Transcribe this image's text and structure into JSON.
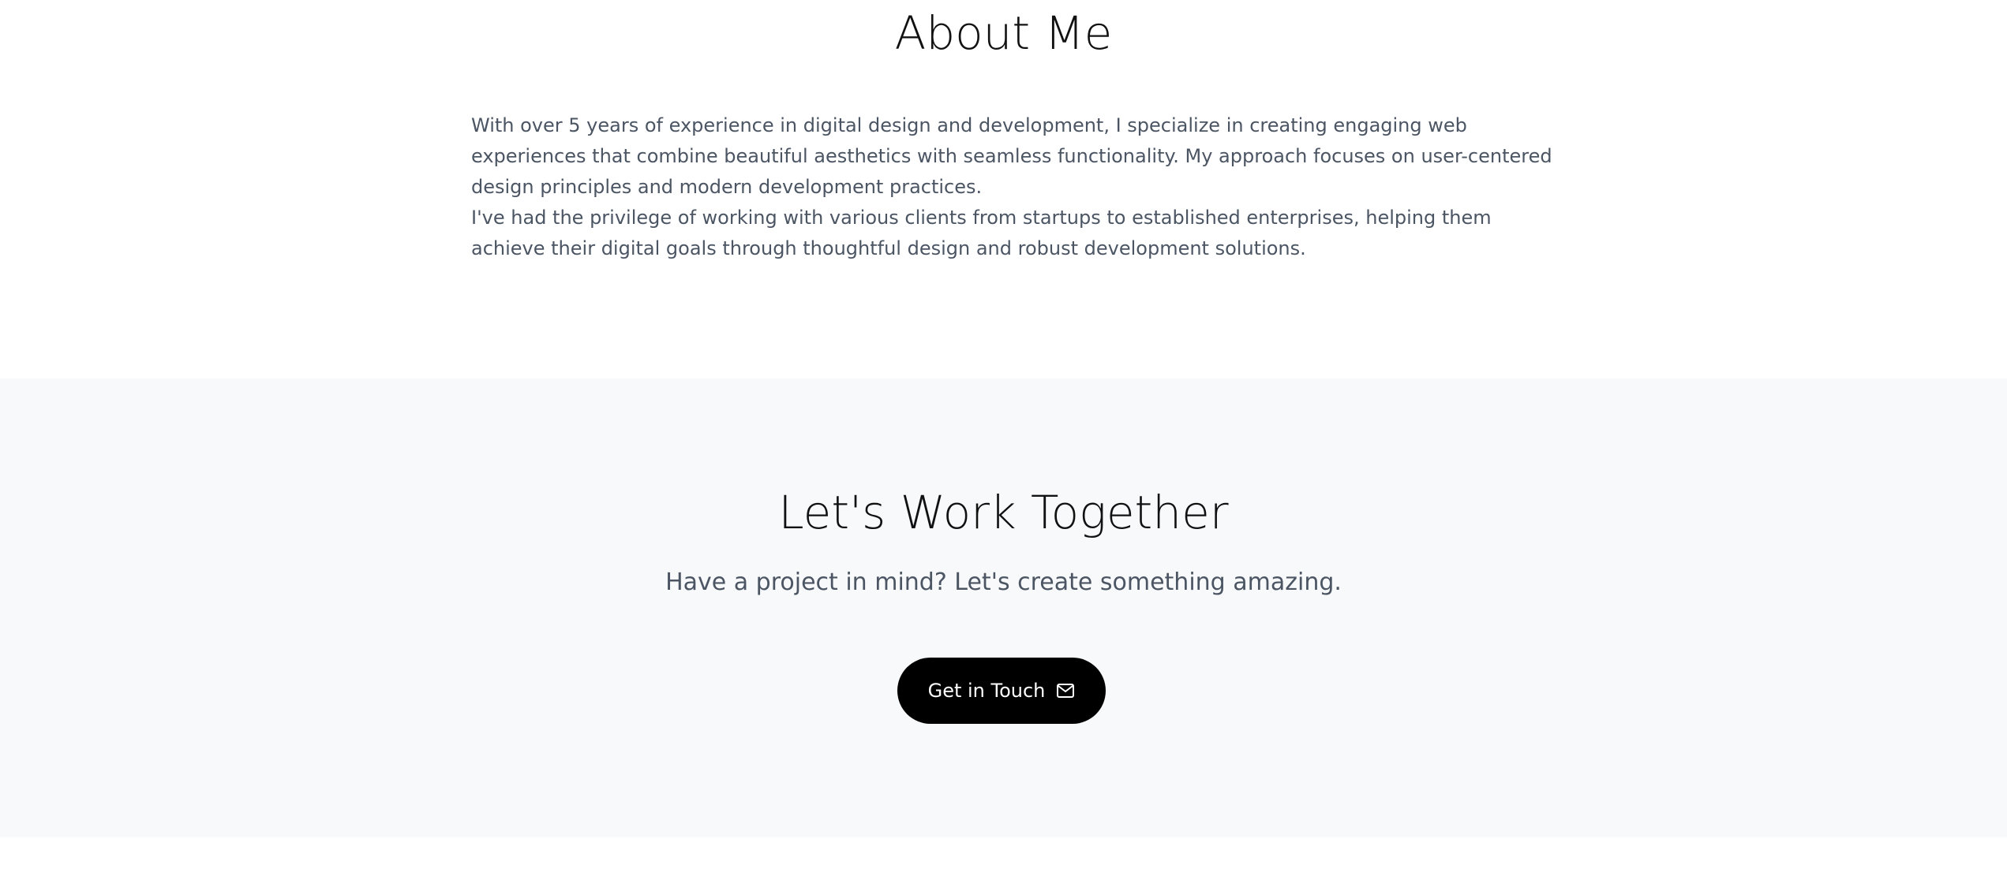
{
  "about": {
    "title": "About Me",
    "paragraphs": [
      "With over 5 years of experience in digital design and development, I specialize in creating engaging web experiences that combine beautiful aesthetics with seamless functionality. My approach focuses on user-centered design principles and modern development practices.",
      "I've had the privilege of working with various clients from startups to established enterprises, helping them achieve their digital goals through thoughtful design and robust development solutions."
    ]
  },
  "cta": {
    "title": "Let's Work Together",
    "subtitle": "Have a project in mind? Let's create something amazing.",
    "button_label": "Get in Touch",
    "button_icon": "mail-icon"
  },
  "colors": {
    "text_primary": "#111111",
    "text_secondary": "#4b5563",
    "cta_background": "#f8f9fa",
    "button_background": "#000000",
    "button_text": "#ffffff"
  }
}
